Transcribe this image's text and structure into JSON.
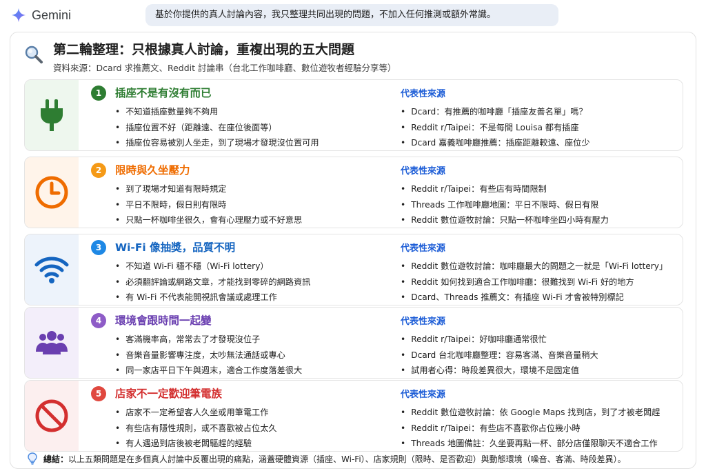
{
  "app": {
    "name": "Gemini"
  },
  "prompt_text": "基於你提供的真人討論內容，我只整理共同出現的問題，不加入任何推測或額外常識。",
  "header": {
    "title": "第二輪整理：只根據真人討論，重複出現的五大問題",
    "subtitle": "資料來源：Dcard 求推薦文、Reddit 討論串（台北工作咖啡廳、數位遊牧者經驗分享等）",
    "icon": "magnifier-icon"
  },
  "source_heading": "代表性來源",
  "colors": {
    "green": "#2e7d32",
    "orange": "#ef6c00",
    "blue": "#1565c0",
    "purple": "#6a3fb0",
    "red": "#d32f2f",
    "link_blue": "#1a5bd6"
  },
  "issues": [
    {
      "number": "1",
      "title": "插座不是有沒有而已",
      "icon": "plug-icon",
      "bullets": [
        "不知道插座數量夠不夠用",
        "插座位置不好（距離遠、在座位後面等）",
        "插座位容易被別人坐走，到了現場才發現沒位置可用"
      ],
      "sources": [
        "Dcard：有推薦的咖啡廳「插座友善名單」嗎？",
        "Reddit r/Taipei：不是每間 Louisa 都有插座",
        "Dcard 嘉義咖啡廳推薦：插座距離較遠、座位少"
      ]
    },
    {
      "number": "2",
      "title": "限時與久坐壓力",
      "icon": "clock-icon",
      "bullets": [
        "到了現場才知道有限時規定",
        "平日不限時，假日則有限時",
        "只點一杯咖啡坐很久，會有心理壓力或不好意思"
      ],
      "sources": [
        "Reddit r/Taipei：有些店有時間限制",
        "Threads 工作咖啡廳地圖：平日不限時、假日有限",
        "Reddit 數位遊牧討論：只點一杯咖啡坐四小時有壓力"
      ]
    },
    {
      "number": "3",
      "title": "Wi-Fi 像抽獎，品質不明",
      "icon": "wifi-icon",
      "bullets": [
        "不知道 Wi-Fi 穩不穩（Wi-Fi lottery）",
        "必須翻評論或網路文章，才能找到零碎的網路資訊",
        "有 Wi-Fi 不代表能開視訊會議或處理工作"
      ],
      "sources": [
        "Reddit 數位遊牧討論：咖啡廳最大的問題之一就是「Wi-Fi lottery」",
        "Reddit 如何找到適合工作咖啡廳：很難找到 Wi-Fi 好的地方",
        "Dcard、Threads 推薦文：有插座 Wi-Fi 才會被特別標記"
      ]
    },
    {
      "number": "4",
      "title": "環境會跟時間一起變",
      "icon": "people-icon",
      "bullets": [
        "客滿機率高，常常去了才發現沒位子",
        "音樂音量影響專注度，太吵無法通話或專心",
        "同一家店平日下午與週末，適合工作度落差很大"
      ],
      "sources": [
        "Reddit r/Taipei：好咖啡廳通常很忙",
        "Dcard 台北咖啡廳整理：容易客滿、音樂音量稍大",
        "試用者心得：時段差異很大，環境不是固定值"
      ]
    },
    {
      "number": "5",
      "title": "店家不一定歡迎筆電族",
      "icon": "no-entry-icon",
      "bullets": [
        "店家不一定希望客人久坐或用筆電工作",
        "有些店有隱性規則，或不喜歡被占位太久",
        "有人遇過到店後被老闆驅趕的經驗"
      ],
      "sources": [
        "Reddit 數位遊牧討論：依 Google Maps 找到店，到了才被老闆趕",
        "Reddit r/Taipei：有些店不喜歡你占位幾小時",
        "Threads 地圖備註：久坐要再點一杯、部分店僅限聊天不適合工作"
      ]
    }
  ],
  "footer": {
    "icon": "lightbulb-icon",
    "label": "總結：",
    "text": "以上五類問題是在多個真人討論中反覆出現的痛點，涵蓋硬體資源（插座、Wi-Fi）、店家規則（限時、是否歡迎）與動態環境（噪音、客滿、時段差異）。"
  }
}
